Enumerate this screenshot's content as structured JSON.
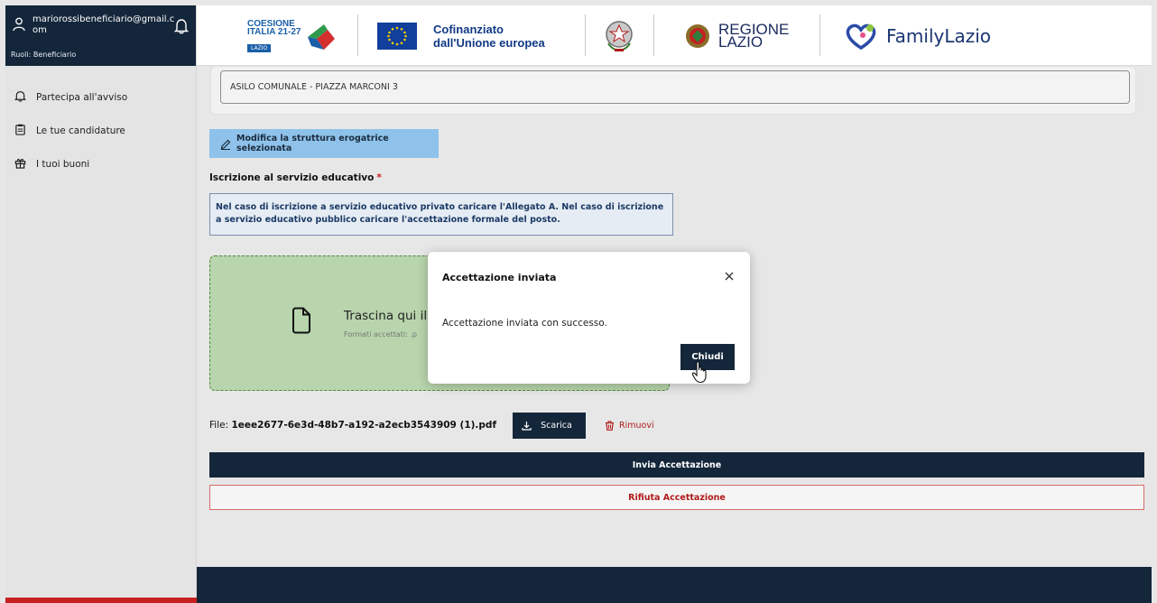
{
  "sidebar": {
    "user_email": "mariorossibeneficiario@gmail.com",
    "user_role": "Ruoli: Beneficiario",
    "items": [
      {
        "label": "Partecipa all'avviso",
        "icon": "bell-icon"
      },
      {
        "label": "Le tue candidature",
        "icon": "clipboard-icon"
      },
      {
        "label": "I tuoi buoni",
        "icon": "gift-icon"
      }
    ]
  },
  "header": {
    "coesione": {
      "line1": "COESIONE",
      "line2": "ITALIA 21-27",
      "badge": "LAZIO"
    },
    "eu_text_1": "Cofinanziato",
    "eu_text_2": "dall'Unione europea",
    "regione_1": "REGIONE",
    "regione_2": "LAZIO",
    "family": "FamilyLazio"
  },
  "main": {
    "structure_value": "ASILO COMUNALE - PIAZZA MARCONI 3",
    "modify_button": "Modifica la struttura erogatrice selezionata",
    "field_label": "Iscrizione al servizio educativo",
    "required_mark": "*",
    "info_text": "Nel caso di iscrizione a servizio educativo privato caricare l'Allegato A. Nel caso di iscrizione a servizio educativo pubblico caricare l'accettazione formale del posto.",
    "drop_title": "Trascina qui il",
    "drop_sub": "Formati accettati: .p",
    "file_prefix": "File:",
    "file_name": "1eee2677-6e3d-48b7-a192-a2ecb3543909 (1).pdf",
    "download_button": "Scarica",
    "remove_button": "Rimuovi",
    "send_button": "Invia Accettazione",
    "refuse_button": "Rifiuta Accettazione"
  },
  "modal": {
    "title": "Accettazione inviata",
    "body": "Accettazione inviata con successo.",
    "ok_button": "Chiudi"
  },
  "colors": {
    "navy": "#14263a",
    "accent_blue": "#8ec2ea",
    "dropzone_green": "#b8d5ad",
    "danger": "#b11a1a"
  }
}
